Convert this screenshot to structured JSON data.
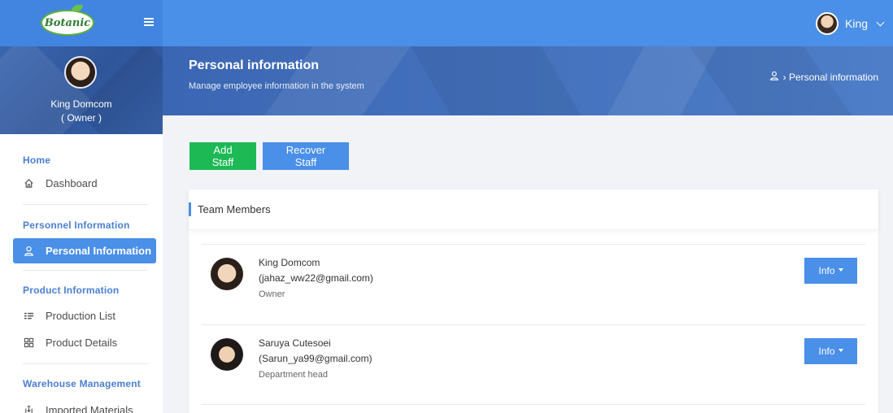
{
  "app": {
    "logo_text": "Botanic",
    "user_name": "King"
  },
  "sidebar": {
    "profile": {
      "name": "King Domcom",
      "role": "( Owner )"
    },
    "sections": [
      {
        "title": "Home",
        "items": [
          {
            "label": "Dashboard",
            "icon": "home-icon"
          }
        ]
      },
      {
        "title": "Personnel Information",
        "items": [
          {
            "label": "Personal Information",
            "icon": "user-icon",
            "active": true
          }
        ]
      },
      {
        "title": "Product Information",
        "items": [
          {
            "label": "Production List",
            "icon": "list-icon"
          },
          {
            "label": "Product Details",
            "icon": "grid-icon"
          }
        ]
      },
      {
        "title": "Warehouse Management",
        "items": [
          {
            "label": "Imported Materials",
            "icon": "import-icon"
          }
        ]
      }
    ]
  },
  "header": {
    "title": "Personal information",
    "subtitle": "Manage employee information in the system",
    "breadcrumb": "› Personal information"
  },
  "actions": {
    "add_staff": "Add Staff",
    "recover_staff": "Recover Staff"
  },
  "team": {
    "title": "Team Members",
    "members": [
      {
        "name": "King Domcom",
        "email": "(jahaz_ww22@gmail.com)",
        "role": "Owner",
        "button": "Info"
      },
      {
        "name": "Saruya Cutesoei",
        "email": "(Sarun_ya99@gmail.com)",
        "role": "Department head",
        "button": "Info"
      }
    ]
  },
  "colors": {
    "primary": "#4a8fe8",
    "success": "#1db955",
    "banner": "#3b66b3",
    "sidebar_accent": "#4a7fd0"
  }
}
